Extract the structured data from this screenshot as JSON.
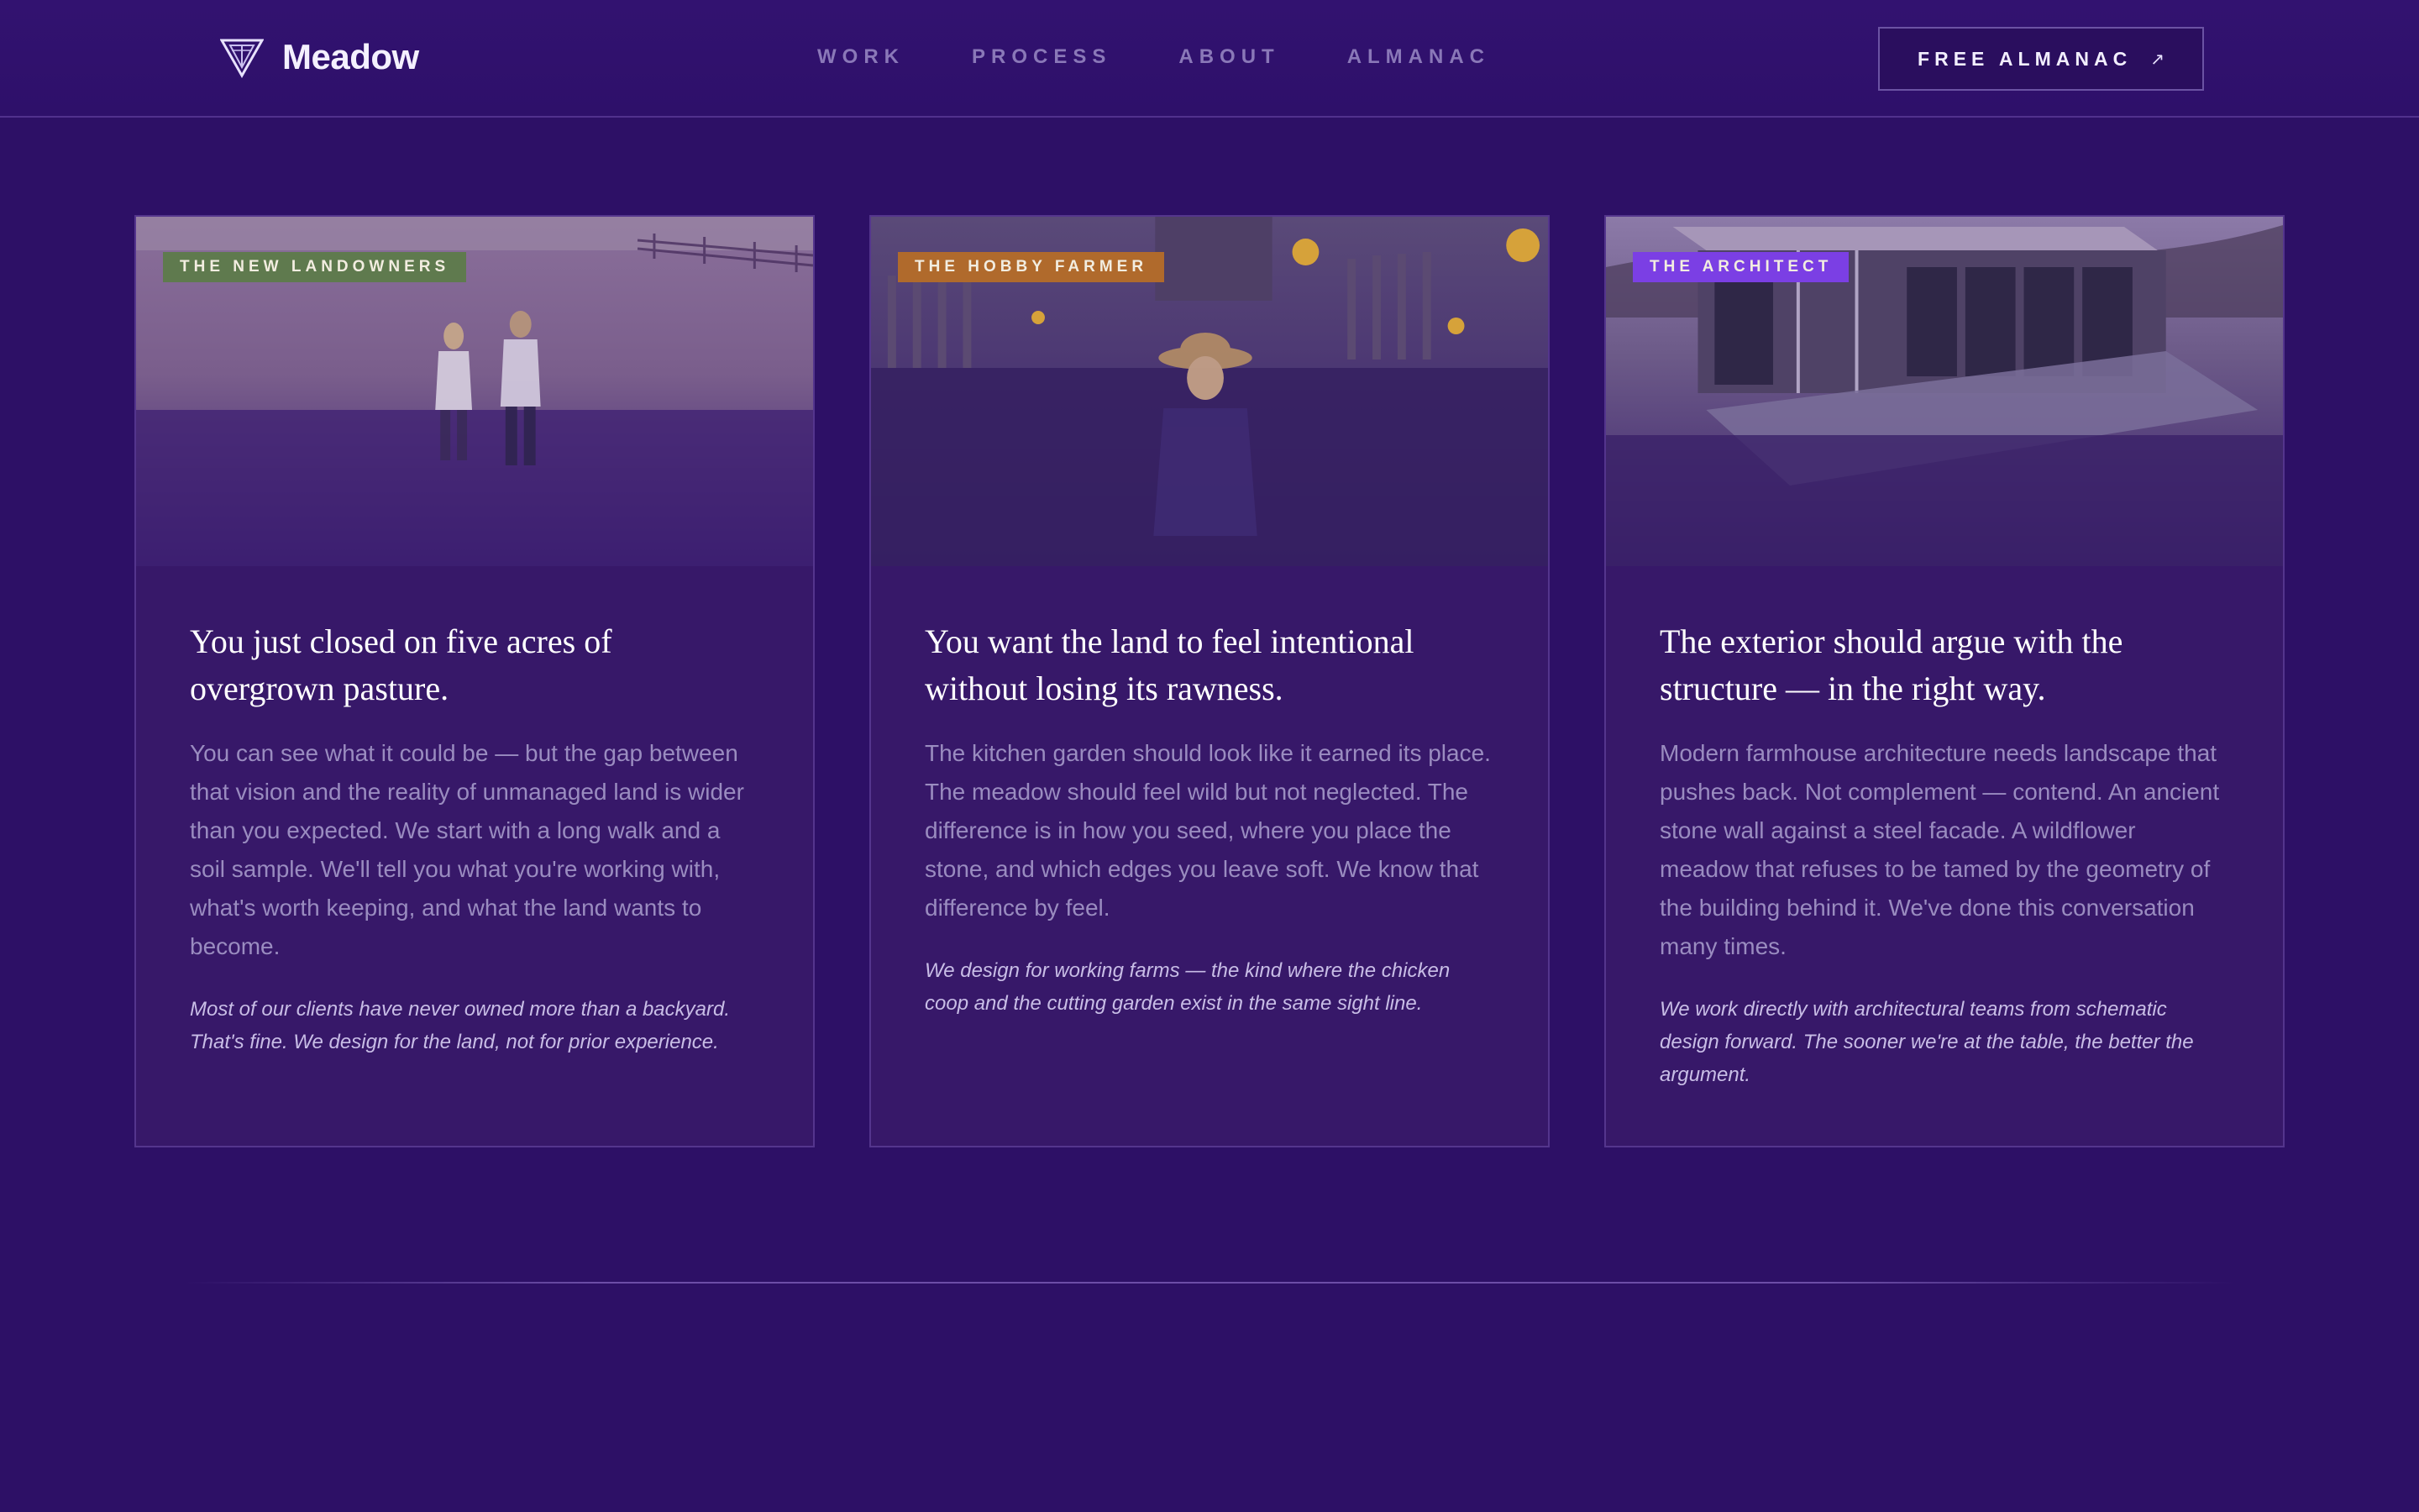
{
  "header": {
    "brand": "Meadow",
    "logo_icon": "triangle-logo-icon",
    "nav": [
      {
        "label": "WORK"
      },
      {
        "label": "PROCESS"
      },
      {
        "label": "ABOUT"
      },
      {
        "label": "ALMANAC"
      }
    ],
    "cta": {
      "label": "FREE ALMANAC",
      "icon": "arrow-up-right-icon"
    }
  },
  "cards": [
    {
      "badge": "THE NEW LANDOWNERS",
      "badge_color": "#5f7a4e",
      "image_icon": "couple-in-field-photo",
      "title": "You just closed on five acres of overgrown pasture.",
      "text": "You can see what it could be — but the gap between that vision and the reality of unmanaged land is wider than you expected. We start with a long walk and a soil sample. We'll tell you what you're working with, what's worth keeping, and what the land wants to become.",
      "note": "Most of our clients have never owned more than a backyard. That's fine. We design for the land, not for prior experience."
    },
    {
      "badge": "THE HOBBY FARMER",
      "badge_color": "#b06a2c",
      "image_icon": "gardener-photo",
      "title": "You want the land to feel intentional without losing its rawness.",
      "text": "The kitchen garden should look like it earned its place. The meadow should feel wild but not neglected. The difference is in how you seed, where you place the stone, and which edges you leave soft. We know that difference by feel.",
      "note": "We design for working farms — the kind where the chicken coop and the cutting garden exist in the same sight line."
    },
    {
      "badge": "THE ARCHITECT",
      "badge_color": "#7b3fe4",
      "image_icon": "modern-farmhouse-photo",
      "title": "The exterior should argue with the structure — in the right way.",
      "text": "Modern farmhouse architecture needs landscape that pushes back. Not complement — contend. An ancient stone wall against a steel facade. A wildflower meadow that refuses to be tamed by the geometry of the building behind it. We've done this conversation many times.",
      "note": "We work directly with architectural teams from schematic design forward. The sooner we're at the table, the better the argument."
    }
  ],
  "colors": {
    "background": "#2d1066",
    "card_background": "#371869",
    "nav_text": "#8a78b8",
    "body_text": "#9a8cc0"
  }
}
